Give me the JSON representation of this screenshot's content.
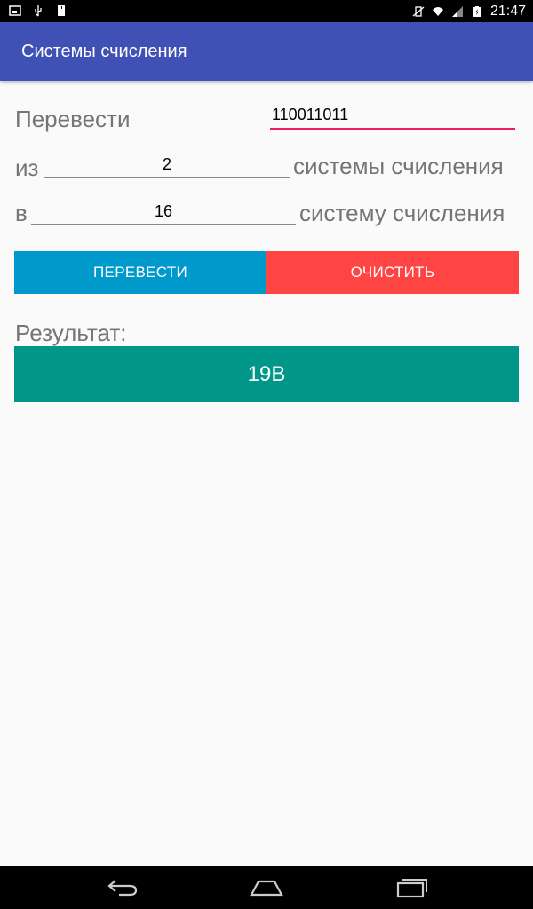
{
  "status_bar": {
    "time": "21:47",
    "icons": [
      "screenshot-icon",
      "usb-icon",
      "sd-card-icon",
      "vibrate-icon",
      "wifi-icon",
      "signal-icon",
      "battery-icon"
    ]
  },
  "app_bar": {
    "title": "Системы счисления",
    "color": "#3f51b5"
  },
  "form": {
    "translate_label": "Перевести",
    "number_value": "110011011",
    "from_label": "из",
    "from_base_value": "2",
    "from_suffix": "системы счисления",
    "to_label": "в",
    "to_base_value": "16",
    "to_suffix": "систему счисления"
  },
  "buttons": {
    "convert_label": "ПЕРЕВЕСТИ",
    "convert_color": "#0099cc",
    "clear_label": "ОЧИСТИТЬ",
    "clear_color": "#ff4444"
  },
  "result": {
    "label": "Результат:",
    "value": "19B",
    "color": "#009688"
  },
  "nav_bar": {
    "icons": [
      "back-icon",
      "home-icon",
      "recents-icon"
    ]
  }
}
